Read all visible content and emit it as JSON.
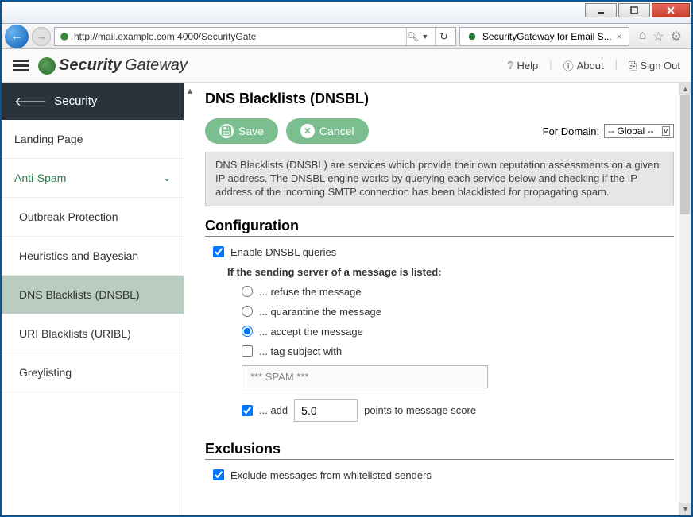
{
  "window": {
    "title": "SecurityGateway for Email S..."
  },
  "browser": {
    "url": "http://mail.example.com:4000/SecurityGate",
    "tab_title": "SecurityGateway for Email S..."
  },
  "header": {
    "brand_bold": "Security",
    "brand_light": "Gateway",
    "links": {
      "help": "Help",
      "about": "About",
      "signout": "Sign Out"
    }
  },
  "sidebar": {
    "back_label": "Security",
    "items": [
      {
        "label": "Landing Page"
      },
      {
        "label": "Anti-Spam",
        "section": true,
        "chevron": true
      },
      {
        "label": "Outbreak Protection",
        "sub": true
      },
      {
        "label": "Heuristics and Bayesian",
        "sub": true
      },
      {
        "label": "DNS Blacklists (DNSBL)",
        "sub": true,
        "active": true
      },
      {
        "label": "URI Blacklists (URIBL)",
        "sub": true
      },
      {
        "label": "Greylisting",
        "sub": true
      }
    ]
  },
  "page": {
    "title": "DNS Blacklists (DNSBL)",
    "save": "Save",
    "cancel": "Cancel",
    "for_domain_label": "For Domain:",
    "for_domain_value": "-- Global --",
    "info": "DNS Blacklists (DNSBL) are services which provide their own reputation assessments on a given IP address. The DNSBL engine works by querying each service below and checking if the IP address of the incoming SMTP connection has been blacklisted for propagating spam.",
    "config_title": "Configuration",
    "enable_label": "Enable DNSBL queries",
    "listed_heading": "If the sending server of a message is listed:",
    "opt_refuse": "... refuse the message",
    "opt_quarantine": "... quarantine the message",
    "opt_accept": "... accept the message",
    "opt_tag": "... tag subject with",
    "tag_value": "*** SPAM ***",
    "opt_add_prefix": "... add",
    "points_value": "5.0",
    "opt_add_suffix": "points to message score",
    "exclusions_title": "Exclusions",
    "exclude_whitelist": "Exclude messages from whitelisted senders"
  }
}
